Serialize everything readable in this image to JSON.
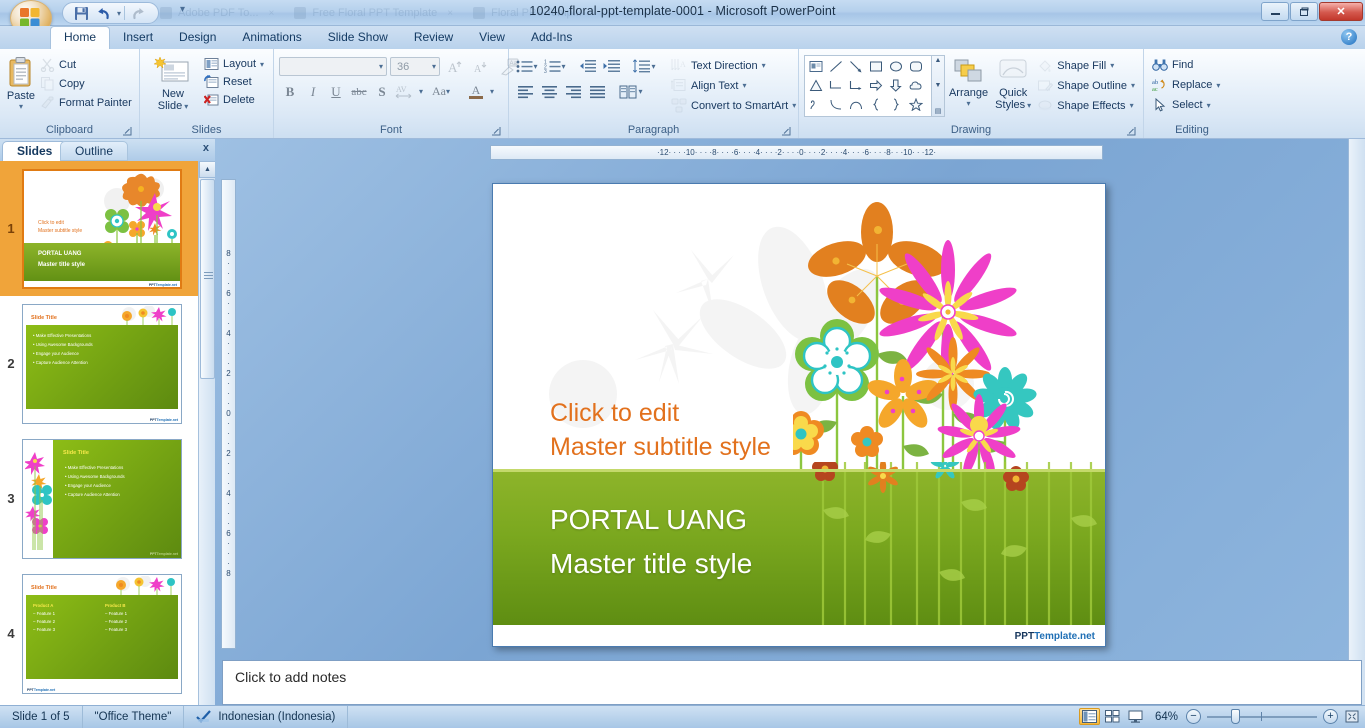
{
  "window": {
    "title": "10240-floral-ppt-template-0001 - Microsoft PowerPoint",
    "minimize": "–",
    "restore": "❐",
    "close": "✕",
    "help": "?"
  },
  "ghost_tabs": [
    {
      "label": "Adobe PDF To...",
      "close": "×"
    },
    {
      "label": "Free Floral PPT Template",
      "close": "×"
    },
    {
      "label": "Floral PPT Temp...",
      "close": "×"
    }
  ],
  "quick_access": {
    "save": "save-icon",
    "undo": "undo-icon",
    "redo": "redo-icon",
    "more": "▾"
  },
  "ribbon": {
    "tabs": [
      {
        "label": "Home",
        "active": true
      },
      {
        "label": "Insert",
        "active": false
      },
      {
        "label": "Design",
        "active": false
      },
      {
        "label": "Animations",
        "active": false
      },
      {
        "label": "Slide Show",
        "active": false
      },
      {
        "label": "Review",
        "active": false
      },
      {
        "label": "View",
        "active": false
      },
      {
        "label": "Add-Ins",
        "active": false
      }
    ],
    "clipboard": {
      "title": "Clipboard",
      "paste": "Paste",
      "cut": "Cut",
      "copy": "Copy",
      "format_painter": "Format Painter",
      "dialog": "⤡"
    },
    "slides": {
      "title": "Slides",
      "new_slide": "New\nSlide",
      "new_slide_l1": "New",
      "new_slide_l2": "Slide",
      "layout": "Layout",
      "reset": "Reset",
      "delete": "Delete"
    },
    "font": {
      "title": "Font",
      "font_name": "",
      "font_size": "36",
      "grow": "A",
      "shrink": "A",
      "clear_formatting": "A̶",
      "bold": "B",
      "italic": "I",
      "underline": "U",
      "strikethrough": "abc",
      "shadow": "S",
      "char_spacing": "AV",
      "change_case": "Aa",
      "font_color": "A",
      "dialog": "⤡"
    },
    "paragraph": {
      "title": "Paragraph",
      "text_direction": "Text Direction",
      "align_text": "Align Text",
      "convert_smartart": "Convert to SmartArt",
      "dialog": "⤡"
    },
    "drawing": {
      "title": "Drawing",
      "arrange": "Arrange",
      "quick_styles_l1": "Quick",
      "quick_styles_l2": "Styles",
      "shape_fill": "Shape Fill",
      "shape_outline": "Shape Outline",
      "shape_effects": "Shape Effects",
      "dialog": "⤡"
    },
    "editing": {
      "title": "Editing",
      "find": "Find",
      "replace": "Replace",
      "select": "Select"
    }
  },
  "left_pane": {
    "tab_slides": "Slides",
    "tab_outline": "Outline",
    "close": "x",
    "thumbnails": [
      {
        "number": "1",
        "selected": true,
        "kind": "title",
        "subtitle_l1": "Click to edit",
        "subtitle_l2": "Master subtitle  style",
        "title_l1": "PORTAL UANG",
        "title_l2": "Master title style",
        "brand1": "PPT",
        "brand2": "Template.net"
      },
      {
        "number": "2",
        "selected": false,
        "kind": "bullets-top",
        "title": "Slide Title",
        "bullets": [
          "Make Effective Presentations",
          "Using Awesome  Backgrounds",
          "Engage your Audience",
          "Capture Audience  Attention"
        ],
        "brand1": "PPT",
        "brand2": "Template.net"
      },
      {
        "number": "3",
        "selected": false,
        "kind": "bullets-side",
        "title": "Slide Title",
        "bullets": [
          "Make Effective Presentations",
          "Using Awesome  Backgrounds",
          "Engage your Audience",
          "Capture Audience  Attention"
        ],
        "brand1": "PPT",
        "brand2": "Template.net"
      },
      {
        "number": "4",
        "selected": false,
        "kind": "two-column",
        "title": "Slide Title",
        "col1_head": "Product A",
        "col2_head": "Product B",
        "col1_items": [
          "Feature 1",
          "Feature 2",
          "Feature 3"
        ],
        "col2_items": [
          "Feature 1",
          "Feature 2",
          "Feature 3"
        ],
        "brand1": "PPT",
        "brand2": "Template.net"
      }
    ]
  },
  "ruler": {
    "horizontal": "·12· · · ·10· · · ·8· · · ·6· · · ·4· · · ·2· · · ·0· · · ·2· · · ·4· · · ·6· · · ·8· · ·10· · ·12·",
    "vertical_marks": [
      "8",
      "6",
      "4",
      "2",
      "0",
      "2",
      "4",
      "6",
      "8"
    ]
  },
  "slide": {
    "subtitle_line1": "Click to edit",
    "subtitle_line2": "Master subtitle style",
    "title_line1": "PORTAL UANG",
    "title_line2": "Master title style",
    "brand_part1": "PPT",
    "brand_part2": "Template.net",
    "subtitle_color": "#e2711d",
    "band_color": "#7ba81f"
  },
  "notes": {
    "placeholder": "Click to add notes"
  },
  "status_bar": {
    "slide_counter": "Slide 1 of 5",
    "theme": "\"Office Theme\"",
    "spellcheck_icon": "spellcheck-icon",
    "language": "Indonesian (Indonesia)",
    "view_normal": "normal-view-icon",
    "view_sorter": "slide-sorter-icon",
    "view_show": "slide-show-icon",
    "zoom_level": "64%",
    "zoom_out": "−",
    "zoom_in": "+",
    "fit_window": "fit-to-window-icon"
  }
}
